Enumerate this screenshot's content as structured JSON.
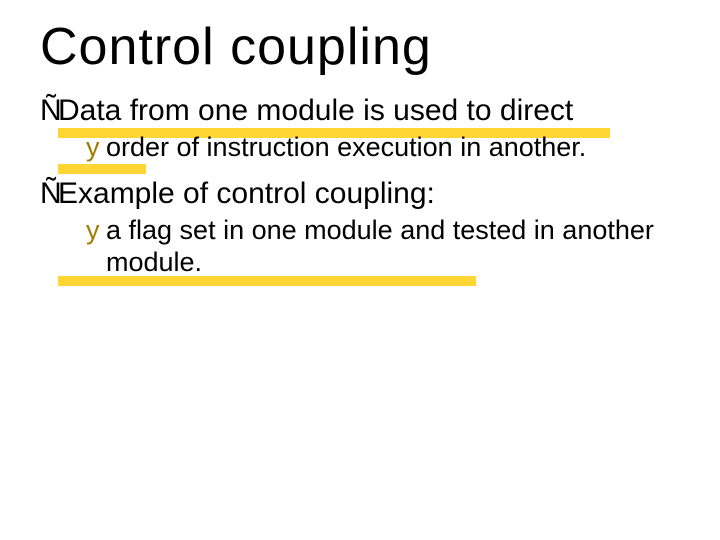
{
  "title": "Control coupling",
  "bullets": {
    "b1": {
      "marker": "Ñ",
      "text": "Data from one module is used to direct",
      "sub_marker": "y",
      "sub_text": "order of instruction execution in another."
    },
    "b2": {
      "marker": "Ñ",
      "text": "Example of control coupling:",
      "sub_marker": "y",
      "sub_text": "a flag set in one module and tested in another module."
    }
  }
}
